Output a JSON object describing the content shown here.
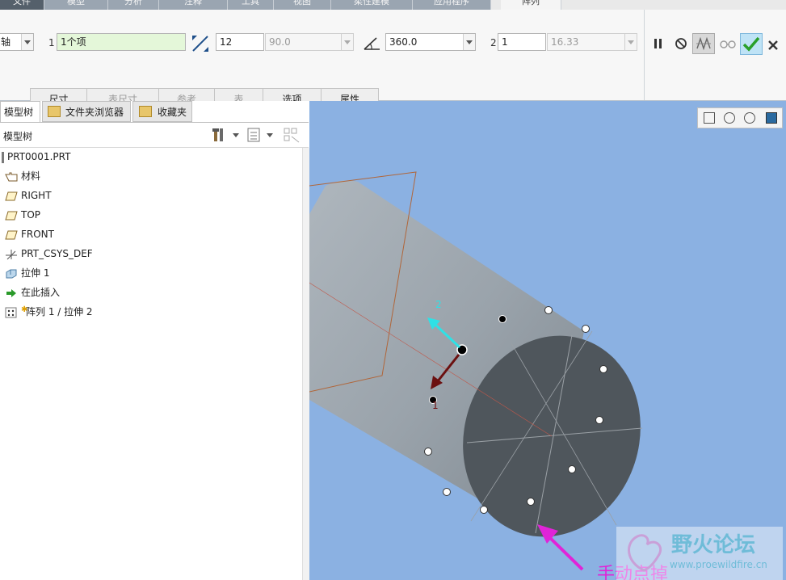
{
  "top_tabs": [
    "文件",
    "模型",
    "分析",
    "注释",
    "工具",
    "视图",
    "柔性建模",
    "应用程序",
    "阵列"
  ],
  "ribbon": {
    "row_label_1": "1",
    "row_label_2": "2",
    "axis_field": "轴",
    "dir1_ref": "1个项",
    "dir1_count": "12",
    "dir1_angle": "90.0",
    "angle_total": "360.0",
    "dir2_count": "1",
    "dir2_spacing": "16.33"
  },
  "sub_tabs": [
    {
      "label": "尺寸",
      "enabled": true
    },
    {
      "label": "表尺寸",
      "enabled": false
    },
    {
      "label": "参考",
      "enabled": false
    },
    {
      "label": "表",
      "enabled": false
    },
    {
      "label": "选项",
      "enabled": true
    },
    {
      "label": "属性",
      "enabled": true
    }
  ],
  "panel_tabs": [
    "模型树",
    "文件夹浏览器",
    "收藏夹"
  ],
  "tree_header": "模型树",
  "tree_items": [
    {
      "label": "PRT0001.PRT",
      "icon": "part-icon"
    },
    {
      "label": "材料",
      "icon": "material-icon"
    },
    {
      "label": "RIGHT",
      "icon": "datum-plane-icon"
    },
    {
      "label": "TOP",
      "icon": "datum-plane-icon"
    },
    {
      "label": "FRONT",
      "icon": "datum-plane-icon"
    },
    {
      "label": "PRT_CSYS_DEF",
      "icon": "csys-icon"
    },
    {
      "label": "拉伸 1",
      "icon": "extrude-icon"
    },
    {
      "label": "在此插入",
      "icon": "insert-here-icon"
    },
    {
      "label": "阵列 1 / 拉伸 2",
      "icon": "pattern-icon"
    }
  ],
  "viewport": {
    "dir_label_1": "1",
    "dir_label_2": "2",
    "annotation": "手动点掉",
    "watermark_title": "野火论坛",
    "watermark_url": "www.proewildfire.cn"
  },
  "colors": {
    "viewport_bg": "#8bb1e2",
    "cylinder": "#9aa3ab",
    "cap": "#4f565c",
    "arrow_magenta": "#e024d8",
    "arrow_cyan": "#2fe1e6",
    "arrow_darkred": "#6b1010",
    "confirm_green": "#2aa02a"
  }
}
